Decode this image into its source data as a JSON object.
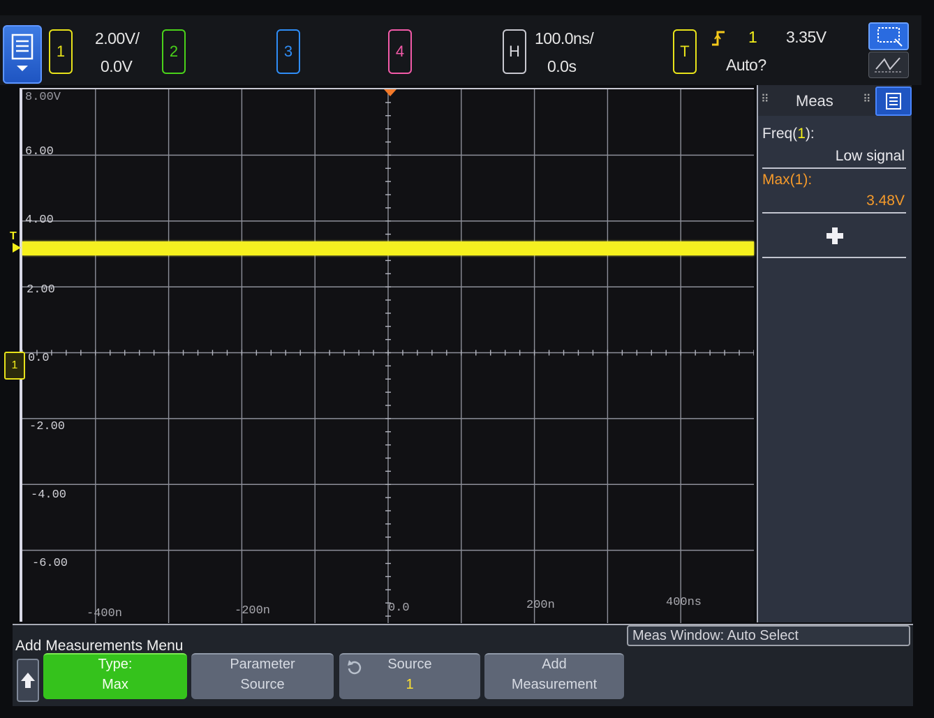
{
  "channel1": {
    "label": "1",
    "scale": "2.00V/",
    "offset": "0.0V",
    "color": "#f4ef1a"
  },
  "channel2": {
    "label": "2",
    "color": "#4ad21a"
  },
  "channel3": {
    "label": "3",
    "color": "#2f8df6"
  },
  "channel4": {
    "label": "4",
    "color": "#f25aa8"
  },
  "horizontal": {
    "label": "H",
    "scale": "100.0ns/",
    "delay": "0.0s"
  },
  "trigger": {
    "label": "T",
    "slope_icon": "rising-edge-icon",
    "source": "1",
    "level": "3.35V",
    "mode": "Auto?",
    "color": "#f4ef1a"
  },
  "grid": {
    "y_labels": [
      "8.00V",
      "6.00",
      "4.00",
      "2.00",
      "0.0",
      "-2.00",
      "-4.00",
      "-6.00"
    ],
    "x_labels": [
      "-400n",
      "-200n",
      "0.0",
      "200n",
      "400ns"
    ]
  },
  "markers": {
    "trigger_level_marker": "T",
    "ground_marker": "1"
  },
  "meas_panel": {
    "title": "Meas",
    "items": [
      {
        "label_prefix": "Freq(",
        "label_ch": "1",
        "label_suffix": "):",
        "value": "Low signal",
        "label_color": "#e6e6ea",
        "value_color": "#ececf0"
      },
      {
        "label_prefix": "Max(",
        "label_ch": "1",
        "label_suffix": "):",
        "value": "3.48V",
        "label_color": "#f59a2a",
        "value_color": "#f59a2a"
      }
    ],
    "add_icon": "plus-icon"
  },
  "softkeys": {
    "menu_title": "Add Measurements Menu",
    "meas_window": "Meas Window: Auto Select",
    "type": {
      "line1": "Type:",
      "line2": "Max"
    },
    "param_source": {
      "line1": "Parameter",
      "line2": "Source"
    },
    "source": {
      "line1": "Source",
      "line2": "1"
    },
    "add_measurement": {
      "line1": "Add",
      "line2": "Measurement"
    }
  }
}
